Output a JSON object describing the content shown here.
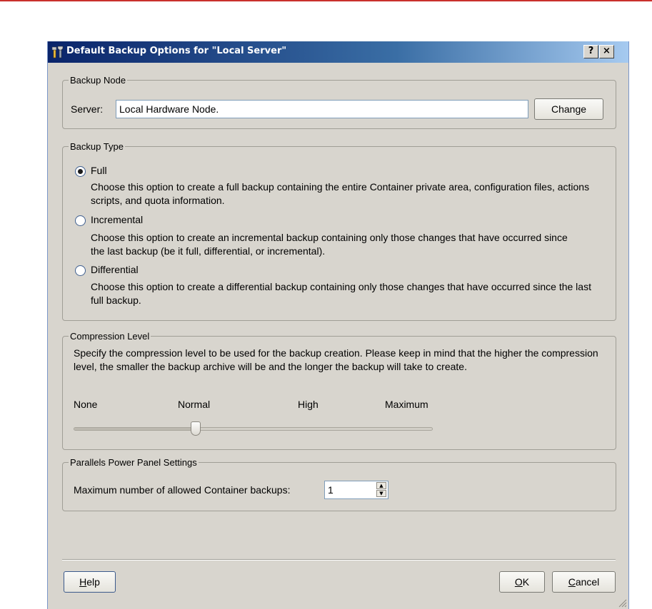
{
  "window": {
    "title": "Default Backup Options for \"Local Server\"",
    "help_glyph": "?",
    "close_glyph": "×",
    "icon": "tools-icon"
  },
  "backup_node": {
    "legend": "Backup Node",
    "server_label": "Server:",
    "server_value": "Local Hardware Node.",
    "change_label": "Change"
  },
  "backup_type": {
    "legend": "Backup Type",
    "options": [
      {
        "label": "Full",
        "description": "Choose this option to create a full backup containing the entire Container private area, configuration files, actions scripts, and quota information.",
        "checked": true
      },
      {
        "label": "Incremental",
        "description": "Choose this option to create an incremental backup containing only those changes that have occurred since the last backup (be it full, differential, or incremental).",
        "checked": false
      },
      {
        "label": "Differential",
        "description": "Choose this option to create a differential backup containing only those changes that have occurred since the last full backup.",
        "checked": false
      }
    ]
  },
  "compression": {
    "legend": "Compression Level",
    "description": "Specify the compression level to be used for the backup creation. Please keep in mind that the higher the compression level, the smaller the backup archive will be and the longer the backup will take to create.",
    "levels": [
      "None",
      "Normal",
      "High",
      "Maximum"
    ],
    "selected_level": "Normal"
  },
  "power_panel": {
    "legend": "Parallels Power Panel Settings",
    "max_backups_label": "Maximum number of allowed Container backups:",
    "max_backups_value": "1"
  },
  "footer": {
    "help_label": "Help",
    "ok_label": "OK",
    "cancel_label": "Cancel"
  },
  "colors": {
    "accent_line": "#c9302c",
    "title_bar_start": "#0a246a",
    "dialog_bg": "#d8d5ce"
  }
}
